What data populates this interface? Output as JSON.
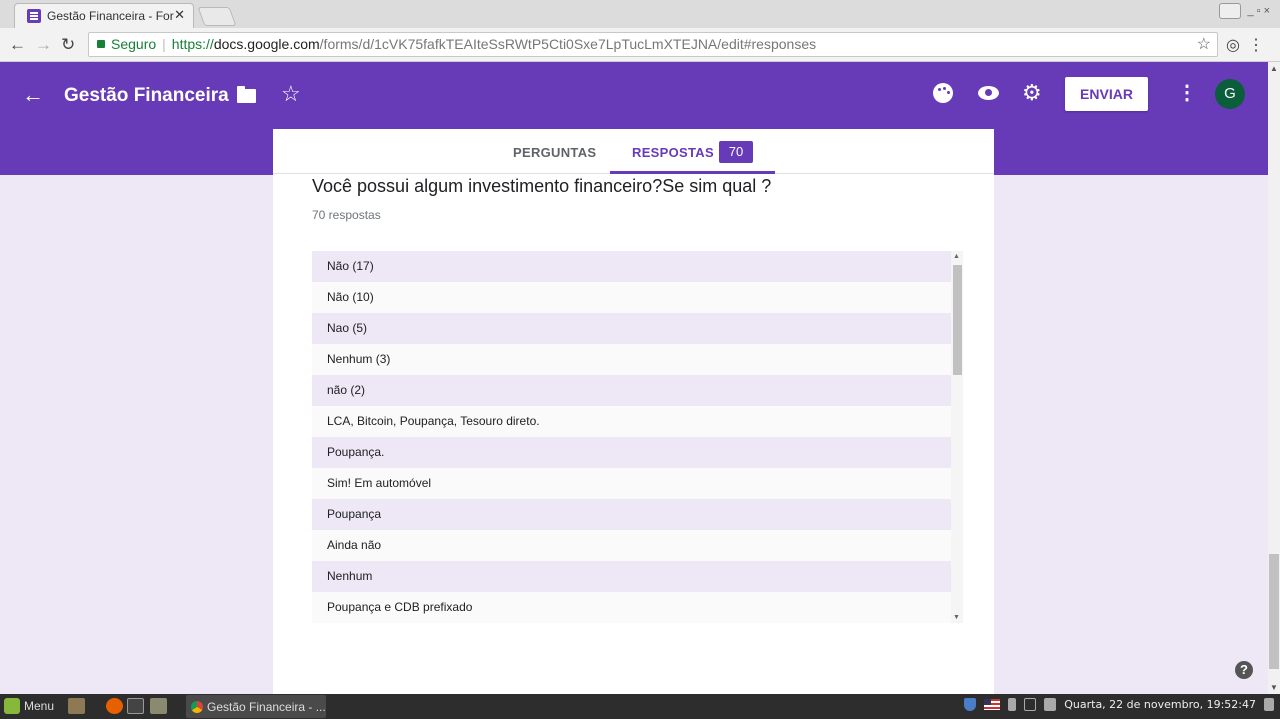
{
  "browser": {
    "tab_title": "Gestão Financeira - For",
    "tab_close": "✕",
    "secure_label": "Seguro",
    "url_scheme": "https://",
    "url_host": "docs.google.com",
    "url_path": "/forms/d/1cVK75fafkTEAIteSsRWtP5Cti0Sxe7LpTucLmXTEJNA/edit#responses",
    "win_buttons": "_ ▫ ×"
  },
  "header": {
    "title": "Gestão Financeira",
    "send_label": "ENVIAR",
    "avatar_initial": "G"
  },
  "tabs": {
    "questions_label": "PERGUNTAS",
    "responses_label": "RESPOSTAS",
    "responses_count": "70"
  },
  "question": {
    "title": "Você possui algum investimento financeiro?Se sim qual ?",
    "response_count": "70 respostas"
  },
  "answers": [
    "Não (17)",
    "Não (10)",
    "Nao (5)",
    "Nenhum (3)",
    "não (2)",
    "LCA, Bitcoin, Poupança, Tesouro direto.",
    "Poupança.",
    "Sim! Em automóvel",
    "Poupança",
    "Ainda não",
    "Nenhum",
    "Poupança e CDB prefixado"
  ],
  "taskbar": {
    "menu_label": "Menu",
    "window_label": "Gestão Financeira - ...",
    "clock": "Quarta, 22 de novembro, 19:52:47"
  },
  "colors": {
    "accent": "#673ab7",
    "row_alt": "#ede7f6",
    "avatar": "#0b5e3c"
  }
}
